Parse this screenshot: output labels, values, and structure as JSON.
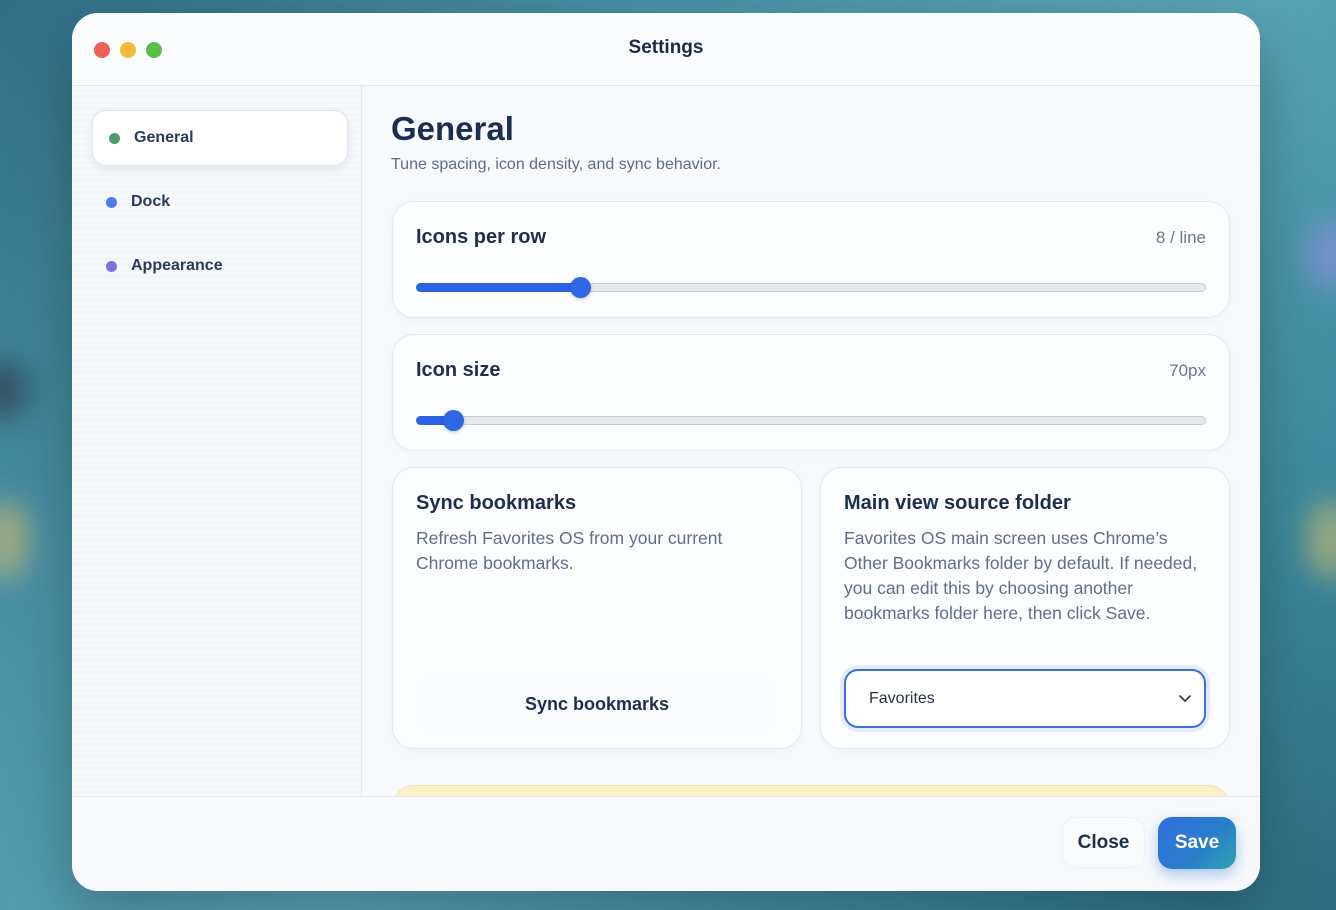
{
  "window": {
    "title": "Settings"
  },
  "sidebar": {
    "items": [
      {
        "label": "General",
        "dot_color": "#4d9a6b",
        "active": true
      },
      {
        "label": "Dock",
        "dot_color": "#4f7de6",
        "active": false
      },
      {
        "label": "Appearance",
        "dot_color": "#7b72e0",
        "active": false
      }
    ]
  },
  "main": {
    "title": "General",
    "subtitle": "Tune spacing, icon density, and sync behavior.",
    "icons_per_row": {
      "label": "Icons per row",
      "value_text": "8 / line",
      "fraction": 0.207
    },
    "icon_size": {
      "label": "Icon size",
      "value_text": "70px",
      "fraction": 0.047
    },
    "sync": {
      "title": "Sync bookmarks",
      "description": "Refresh Favorites OS from your current Chrome bookmarks.",
      "button_label": "Sync bookmarks"
    },
    "source_folder": {
      "title": "Main view source folder",
      "description": "Favorites OS main screen uses Chrome’s Other Bookmarks folder by default. If needed, you can edit this by choosing another bookmarks folder here, then click Save.",
      "selected": "Favorites"
    }
  },
  "footer": {
    "close_label": "Close",
    "save_label": "Save"
  },
  "colors": {
    "accent": "#2f66e6",
    "title_text": "#1c2f4c"
  }
}
